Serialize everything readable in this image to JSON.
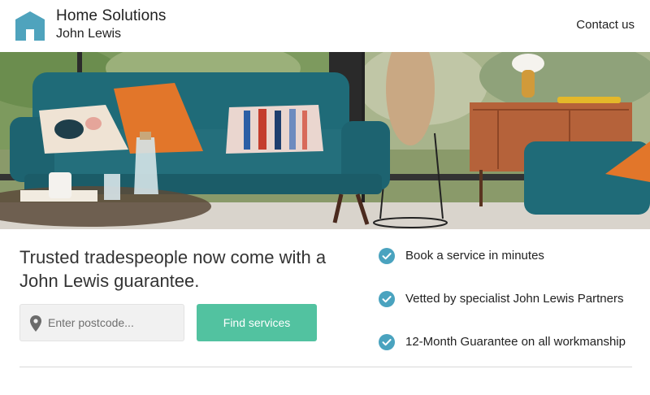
{
  "header": {
    "brand_title": "Home Solutions",
    "brand_subtitle": "John Lewis",
    "contact_label": "Contact us",
    "logo_icon": "house-icon"
  },
  "hero": {
    "image": "living-room-teal-sofa-photo"
  },
  "main": {
    "headline": "Trusted tradespeople now come with a John Lewis guarantee.",
    "postcode_placeholder": "Enter postcode...",
    "find_button_label": "Find services"
  },
  "benefits": [
    {
      "icon": "check-circle-icon",
      "text": "Book a service in minutes"
    },
    {
      "icon": "check-circle-icon",
      "text": "Vetted by specialist John Lewis Partners"
    },
    {
      "icon": "check-circle-icon",
      "text": "12-Month Guarantee on all workmanship"
    }
  ],
  "colors": {
    "brand_teal": "#4fa3bd",
    "button_green": "#52c2a0",
    "check_teal": "#4aa3bf",
    "text": "#222222"
  }
}
